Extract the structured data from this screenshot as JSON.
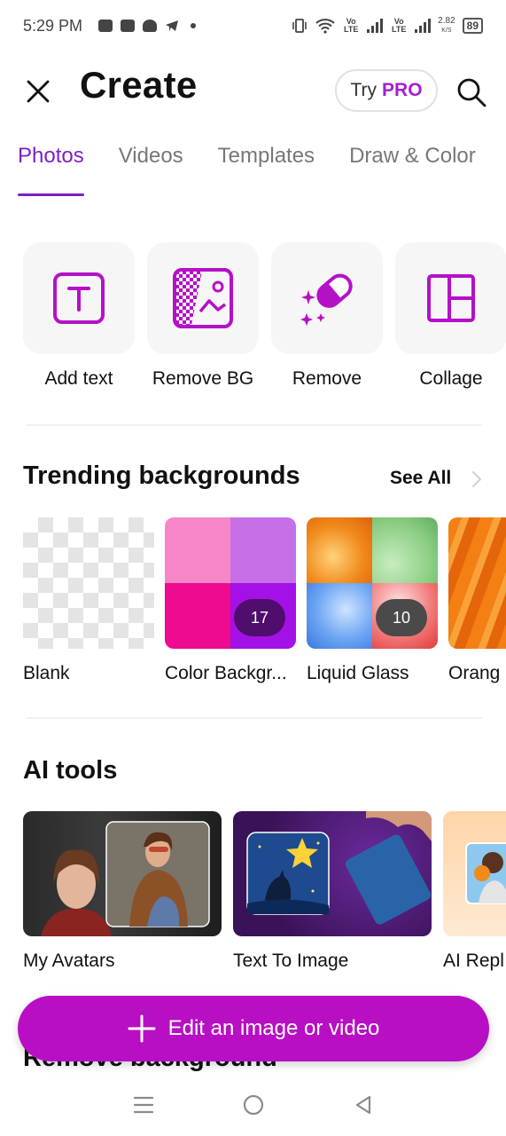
{
  "status_bar": {
    "time": "5:29 PM",
    "net_speed_value": "2.82",
    "net_speed_unit": "K/S",
    "battery": "89",
    "sim1_label": "Vo LTE",
    "sim2_label": "Vo LTE",
    "icons": [
      "game-icon",
      "youtube-icon",
      "snapchat-icon",
      "telegram-icon",
      "dot-icon",
      "vibrate-icon",
      "wifi-icon",
      "signal-icon",
      "battery-icon"
    ]
  },
  "header": {
    "title": "Create",
    "try_label": "Try",
    "pro_label": "PRO"
  },
  "tabs": [
    {
      "label": "Photos",
      "active": true
    },
    {
      "label": "Videos",
      "active": false
    },
    {
      "label": "Templates",
      "active": false
    },
    {
      "label": "Draw & Color",
      "active": false
    }
  ],
  "quick_tools": [
    {
      "label": "Add text",
      "icon": "text-icon"
    },
    {
      "label": "Remove BG",
      "icon": "remove-bg-icon"
    },
    {
      "label": "Remove",
      "icon": "eraser-icon"
    },
    {
      "label": "Collage",
      "icon": "collage-icon"
    }
  ],
  "trending": {
    "title": "Trending backgrounds",
    "see_all": "See All",
    "items": [
      {
        "label": "Blank"
      },
      {
        "label": "Color Backgr...",
        "count": "17"
      },
      {
        "label": "Liquid Glass",
        "count": "10"
      },
      {
        "label": "Orang"
      }
    ]
  },
  "ai_tools": {
    "title": "AI tools",
    "items": [
      {
        "label": "My Avatars"
      },
      {
        "label": "Text To Image"
      },
      {
        "label": "AI Repl"
      }
    ]
  },
  "next_section_title": "Remove background",
  "fab": {
    "label": "Edit an image or video"
  },
  "colors": {
    "accent": "#7a1fc9",
    "fab": "#b80fc4",
    "pro": "#a51fcf"
  }
}
